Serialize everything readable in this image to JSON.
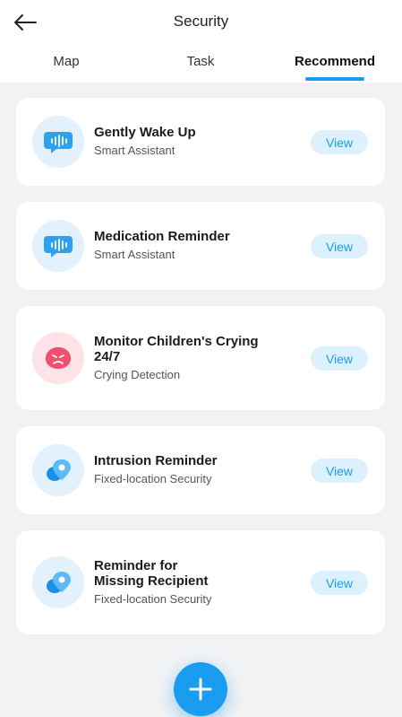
{
  "header": {
    "title": "Security",
    "tabs": [
      {
        "label": "Map"
      },
      {
        "label": "Task"
      },
      {
        "label": "Recommend"
      }
    ],
    "active_tab": "Recommend"
  },
  "cards": [
    {
      "title": "Gently Wake Up",
      "subtitle": "Smart Assistant",
      "icon": "voice-assistant-icon",
      "view_label": "View"
    },
    {
      "title": "Medication Reminder",
      "subtitle": "Smart Assistant",
      "icon": "voice-assistant-icon",
      "view_label": "View"
    },
    {
      "title": "Monitor Children's Crying 24/7",
      "subtitle": "Crying Detection",
      "icon": "crying-face-icon",
      "view_label": "View"
    },
    {
      "title": "Intrusion Reminder",
      "subtitle": "Fixed-location Security",
      "icon": "location-pin-icon",
      "view_label": "View"
    },
    {
      "title": "Reminder for Missing Recipient",
      "subtitle": "Fixed-location Security",
      "icon": "location-pin-icon",
      "view_label": "View"
    }
  ],
  "colors": {
    "accent": "#1a9cf0",
    "view_button_bg": "#dcf0fd",
    "background": "#f1f2f4",
    "icon_blue_bg": "#e3f1fc",
    "icon_pink_bg": "#fde3e8",
    "pink_accent": "#f0506e"
  }
}
